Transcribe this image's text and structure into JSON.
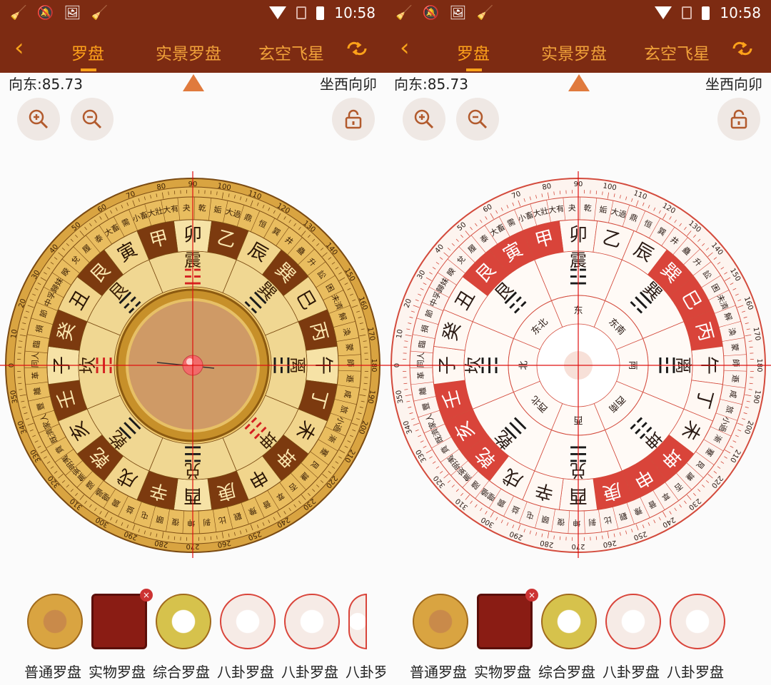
{
  "status": {
    "time": "10:58"
  },
  "toolbar": {
    "tabs": [
      "罗盘",
      "实景罗盘",
      "玄空飞星"
    ],
    "active_tab": "罗盘",
    "accent": "#ffa21a",
    "background": "#7d2b12"
  },
  "info": {
    "direction_reading": "向东:85.73",
    "sitting_facing": "坐西向卯"
  },
  "controls": {
    "zoom_in": "zoom-in-icon",
    "zoom_out": "zoom-out-icon",
    "lock": "lock-icon"
  },
  "compass": {
    "ring_stems_branches": [
      "卯",
      "乙",
      "辰",
      "巽",
      "巳",
      "丙",
      "午",
      "丁",
      "未",
      "坤",
      "申",
      "庚",
      "酉",
      "辛",
      "戌",
      "乾",
      "亥",
      "壬",
      "子",
      "癸",
      "丑",
      "艮",
      "寅",
      "甲"
    ],
    "trigrams": [
      "震",
      "巽",
      "离",
      "坤",
      "兑",
      "乾",
      "坎",
      "艮"
    ],
    "inner_directions": [
      "东",
      "东南",
      "南",
      "西南",
      "西",
      "西北",
      "北",
      "东北"
    ],
    "degree_labels": [
      "0",
      "10",
      "20",
      "30",
      "40",
      "50",
      "60",
      "70",
      "80",
      "90",
      "100",
      "110",
      "120",
      "130",
      "140",
      "150",
      "160",
      "170",
      "180",
      "190",
      "200",
      "210",
      "220",
      "230",
      "240",
      "250",
      "260",
      "270",
      "280",
      "290",
      "300",
      "310",
      "320",
      "330",
      "340",
      "350"
    ],
    "hexagrams_sample": [
      "同人",
      "臨",
      "損",
      "節",
      "中孚",
      "歸妹",
      "睽",
      "兌",
      "履",
      "泰",
      "大畜",
      "需",
      "小畜",
      "大壯",
      "大有",
      "夬",
      "乾",
      "姤",
      "大過",
      "鼎",
      "恒",
      "巽",
      "井",
      "蠱",
      "升",
      "訟",
      "困",
      "未濟",
      "解",
      "渙",
      "蒙",
      "師",
      "遯",
      "咸",
      "旅",
      "小過",
      "漸",
      "蹇",
      "艮",
      "謙",
      "否",
      "萃",
      "晉",
      "豫",
      "觀",
      "比",
      "剝",
      "坤",
      "復",
      "頤",
      "屯",
      "益",
      "震",
      "噬嗑",
      "隨",
      "無妄",
      "明夷",
      "賁",
      "既濟",
      "家人",
      "豐",
      "離",
      "革"
    ]
  },
  "thumbnails_left": [
    "普通罗盘",
    "实物罗盘",
    "综合罗盘",
    "八卦罗盘",
    "八卦罗盘",
    "八卦罗"
  ],
  "thumbnails_right": [
    "普通罗盘",
    "实物罗盘",
    "综合罗盘",
    "八卦罗盘",
    "八卦罗盘"
  ]
}
